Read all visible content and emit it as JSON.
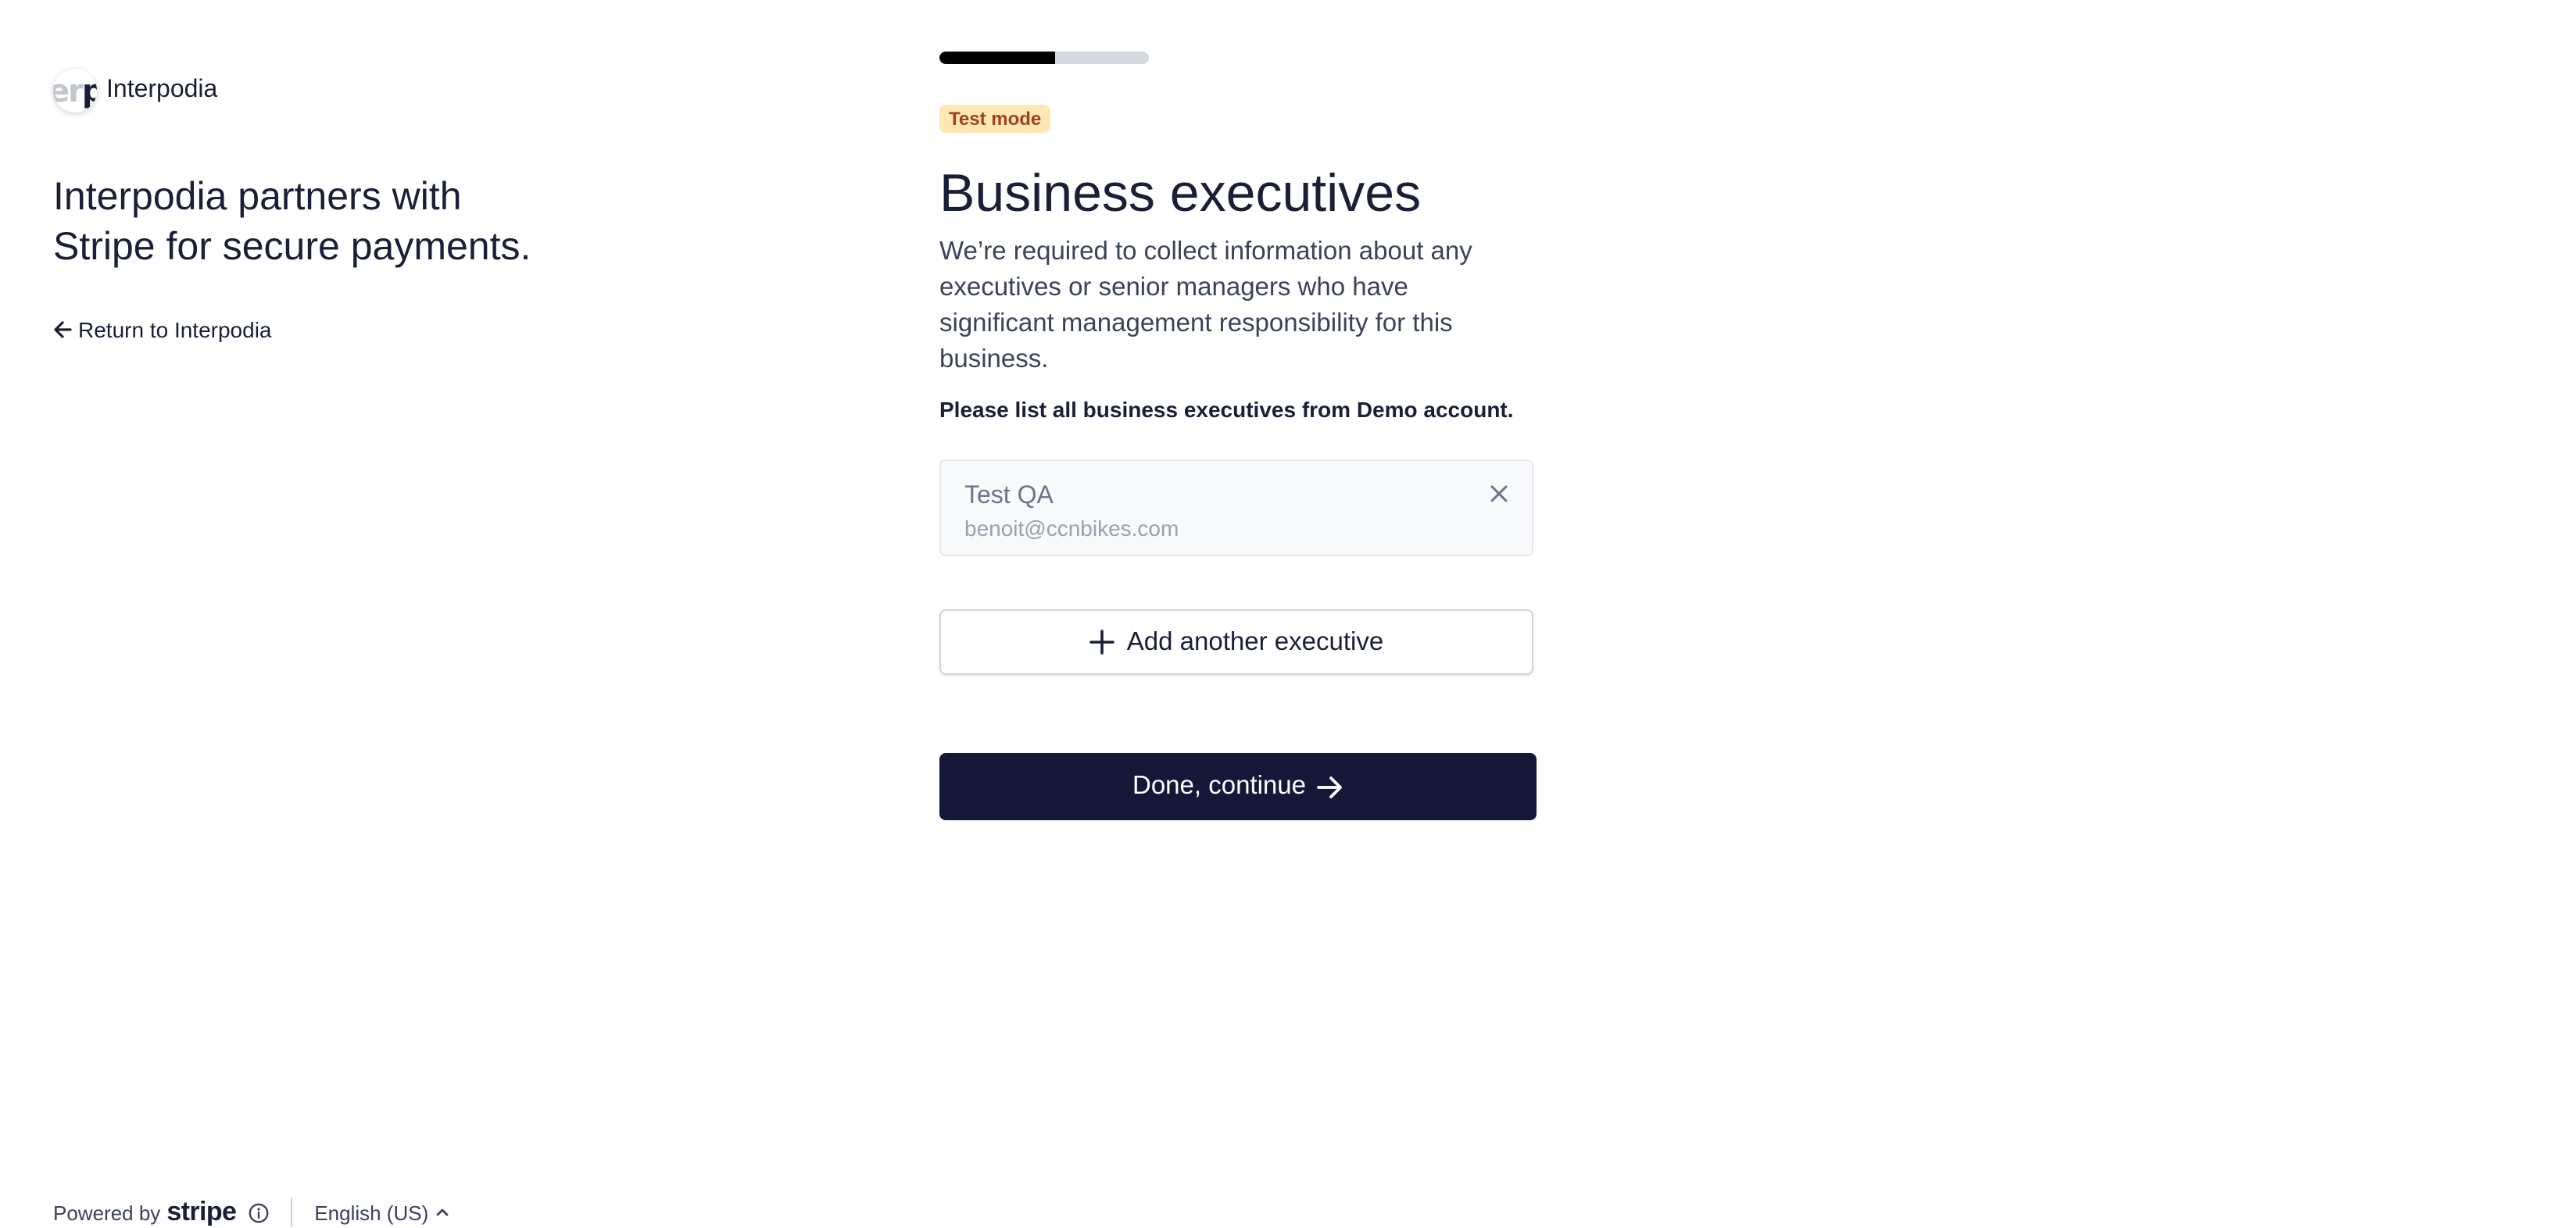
{
  "brand": {
    "logo_text_fade": "er",
    "logo_text_dark": "p",
    "name": "Interpodia",
    "tagline": "Interpodia partners with Stripe for secure payments.",
    "return_link": "Return to Interpodia"
  },
  "footer": {
    "powered_by": "Powered by",
    "stripe": "stripe",
    "language": "English (US)"
  },
  "progress": {
    "fraction": 0.55
  },
  "form": {
    "test_mode_badge": "Test mode",
    "title": "Business executives",
    "description": "We’re required to collect information about any executives or senior managers who have significant management responsibility for this business.",
    "instruction": "Please list all business executives from Demo account.",
    "executives": [
      {
        "name": "Test QA",
        "email": "benoit@ccnbikes.com"
      }
    ],
    "add_button": "Add another executive",
    "continue_button": "Done, continue"
  },
  "colors": {
    "primary_button": "#141738",
    "progress_fill": "#000000",
    "progress_track": "#d5d9df",
    "badge_bg": "#fde8b4",
    "badge_text": "#a0421f"
  },
  "icons": {
    "return": "arrow-left-icon",
    "remove": "close-icon",
    "add": "plus-icon",
    "continue": "arrow-right-icon",
    "info": "info-icon",
    "language": "chevron-up-icon"
  }
}
